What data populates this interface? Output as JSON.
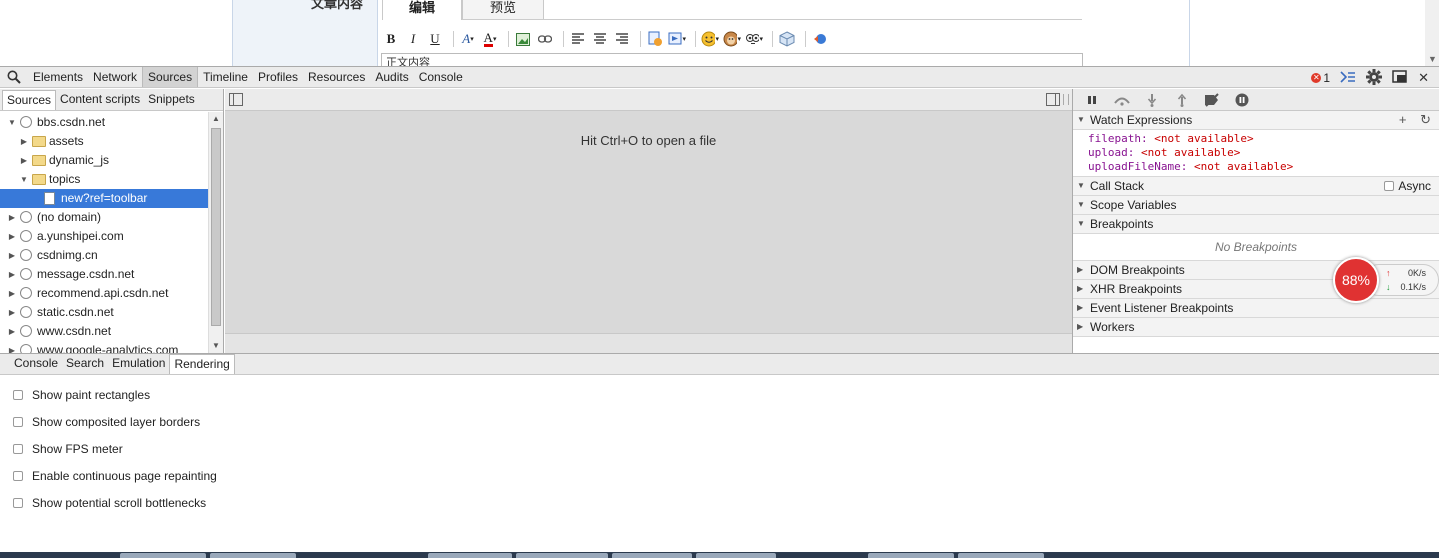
{
  "page": {
    "left_label": "文章内容",
    "editor_tabs": [
      {
        "label": "编辑",
        "active": true
      },
      {
        "label": "预览",
        "active": false
      }
    ],
    "editor_text": "正文内容"
  },
  "devtools": {
    "panels": [
      "Elements",
      "Network",
      "Sources",
      "Timeline",
      "Profiles",
      "Resources",
      "Audits",
      "Console"
    ],
    "active_panel": "Sources",
    "error_count": "1"
  },
  "navigator": {
    "tabs": [
      "Sources",
      "Content scripts",
      "Snippets"
    ],
    "tree": [
      {
        "label": "bbs.csdn.net",
        "type": "domain",
        "level": 0,
        "expanded": true
      },
      {
        "label": "assets",
        "type": "folder",
        "level": 1,
        "expanded": false
      },
      {
        "label": "dynamic_js",
        "type": "folder",
        "level": 1,
        "expanded": false
      },
      {
        "label": "topics",
        "type": "folder",
        "level": 1,
        "expanded": true
      },
      {
        "label": "new?ref=toolbar",
        "type": "file",
        "level": 2,
        "selected": true
      },
      {
        "label": "(no domain)",
        "type": "domain",
        "level": 0,
        "expanded": false
      },
      {
        "label": "a.yunshipei.com",
        "type": "domain",
        "level": 0,
        "expanded": false
      },
      {
        "label": "csdnimg.cn",
        "type": "domain",
        "level": 0,
        "expanded": false
      },
      {
        "label": "message.csdn.net",
        "type": "domain",
        "level": 0,
        "expanded": false
      },
      {
        "label": "recommend.api.csdn.net",
        "type": "domain",
        "level": 0,
        "expanded": false
      },
      {
        "label": "static.csdn.net",
        "type": "domain",
        "level": 0,
        "expanded": false
      },
      {
        "label": "www.csdn.net",
        "type": "domain",
        "level": 0,
        "expanded": false
      },
      {
        "label": "www.google-analytics.com",
        "type": "domain",
        "level": 0,
        "expanded": false
      }
    ]
  },
  "editor": {
    "hint": "Hit Ctrl+O to open a file"
  },
  "sidebar": {
    "watch": {
      "title": "Watch Expressions",
      "items": [
        {
          "name": "filepath",
          "value": "<not available>"
        },
        {
          "name": "upload",
          "value": "<not available>"
        },
        {
          "name": "uploadFileName",
          "value": "<not available>"
        }
      ]
    },
    "call_stack": {
      "title": "Call Stack",
      "async_label": "Async"
    },
    "scope": {
      "title": "Scope Variables"
    },
    "breakpoints": {
      "title": "Breakpoints",
      "empty": "No Breakpoints"
    },
    "collapsed": [
      "DOM Breakpoints",
      "XHR Breakpoints",
      "Event Listener Breakpoints",
      "Workers"
    ]
  },
  "speed_widget": {
    "percent": "88%",
    "up": "0K/s",
    "down": "0.1K/s"
  },
  "drawer": {
    "tabs": [
      "Console",
      "Search",
      "Emulation",
      "Rendering"
    ],
    "active_tab": "Rendering",
    "options": [
      "Show paint rectangles",
      "Show composited layer borders",
      "Show FPS meter",
      "Enable continuous page repainting",
      "Show potential scroll bottlenecks"
    ]
  }
}
